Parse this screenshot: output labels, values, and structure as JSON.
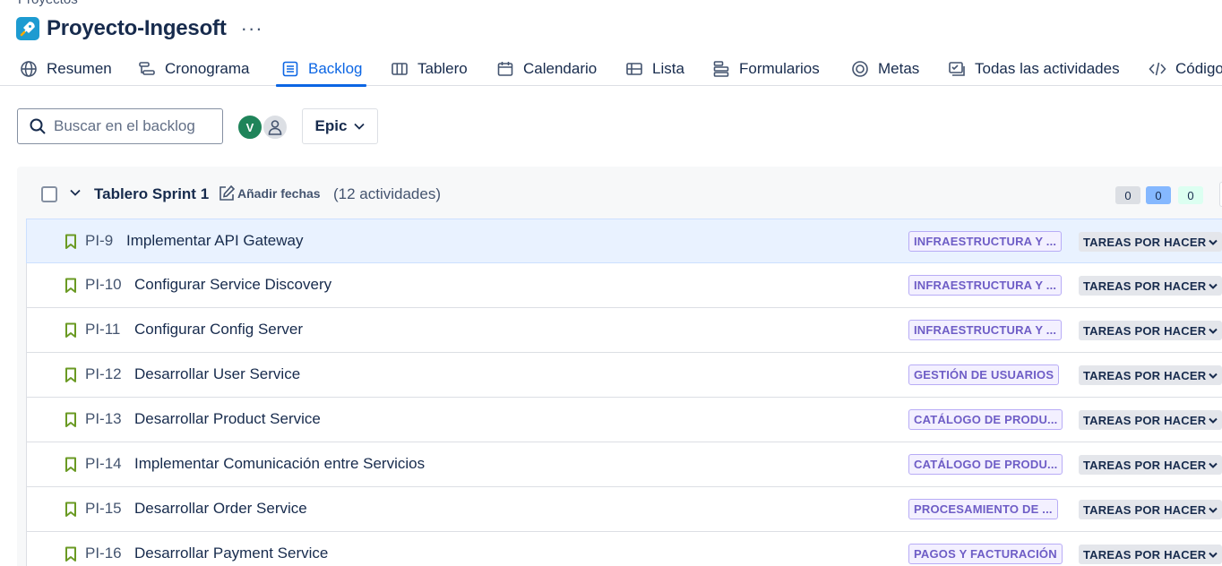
{
  "breadcrumb": "Proyectos",
  "project": {
    "title": "Proyecto-Ingesoft",
    "more": "···"
  },
  "tabs": [
    {
      "label": "Resumen",
      "icon": "globe-icon"
    },
    {
      "label": "Cronograma",
      "icon": "timeline-icon"
    },
    {
      "label": "Backlog",
      "icon": "backlog-icon",
      "active": true
    },
    {
      "label": "Tablero",
      "icon": "board-icon"
    },
    {
      "label": "Calendario",
      "icon": "calendar-icon"
    },
    {
      "label": "Lista",
      "icon": "list-icon"
    },
    {
      "label": "Formularios",
      "icon": "forms-icon"
    },
    {
      "label": "Metas",
      "icon": "goals-icon"
    },
    {
      "label": "Todas las actividades",
      "icon": "activities-icon"
    },
    {
      "label": "Código",
      "icon": "code-icon"
    }
  ],
  "search": {
    "placeholder": "Buscar en el backlog"
  },
  "avatars": {
    "user_initial": "V"
  },
  "epic_filter": {
    "label": "Epic"
  },
  "sprint": {
    "name": "Tablero Sprint 1",
    "add_dates": "Añadir fechas",
    "count": "(12 actividades)",
    "todo_count": "0",
    "in_progress_count": "0",
    "done_count": "0"
  },
  "issues": [
    {
      "key": "PI-9",
      "summary": "Implementar API Gateway",
      "epic": "INFRAESTRUCTURA Y ...",
      "status": "TAREAS POR HACER"
    },
    {
      "key": "PI-10",
      "summary": "Configurar Service Discovery",
      "epic": "INFRAESTRUCTURA Y ...",
      "status": "TAREAS POR HACER"
    },
    {
      "key": "PI-11",
      "summary": "Configurar Config Server",
      "epic": "INFRAESTRUCTURA Y ...",
      "status": "TAREAS POR HACER"
    },
    {
      "key": "PI-12",
      "summary": "Desarrollar User Service",
      "epic": "GESTIÓN DE USUARIOS",
      "status": "TAREAS POR HACER"
    },
    {
      "key": "PI-13",
      "summary": "Desarrollar Product Service",
      "epic": "CATÁLOGO DE PRODU...",
      "status": "TAREAS POR HACER"
    },
    {
      "key": "PI-14",
      "summary": "Implementar Comunicación entre Servicios",
      "epic": "CATÁLOGO DE PRODU...",
      "status": "TAREAS POR HACER"
    },
    {
      "key": "PI-15",
      "summary": "Desarrollar Order Service",
      "epic": "PROCESAMIENTO DE ...",
      "status": "TAREAS POR HACER"
    },
    {
      "key": "PI-16",
      "summary": "Desarrollar Payment Service",
      "epic": "PAGOS Y FACTURACIÓN",
      "status": "TAREAS POR HACER"
    }
  ]
}
